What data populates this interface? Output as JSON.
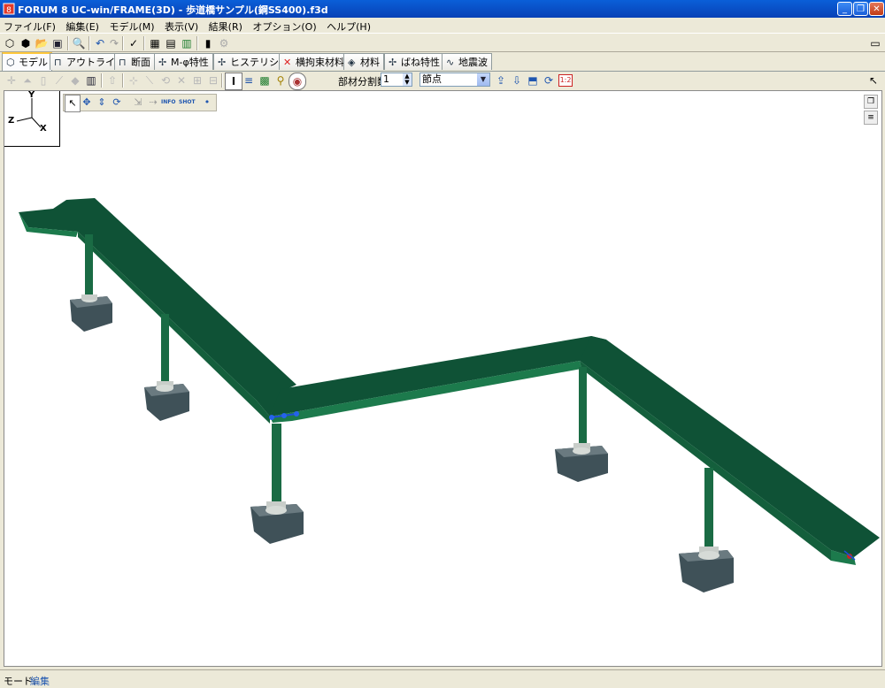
{
  "window": {
    "title": "FORUM 8  UC-win/FRAME(3D) - 歩道橋サンプル(鋼SS400).f3d",
    "minimize_icon": "minimize-icon",
    "maximize_icon": "restore-icon",
    "close_icon": "close-icon"
  },
  "menu": [
    "ファイル(F)",
    "編集(E)",
    "モデル(M)",
    "表示(V)",
    "結果(R)",
    "オプション(O)",
    "ヘルプ(H)"
  ],
  "tabs": [
    {
      "label": "モデル",
      "icon": "model-icon",
      "active": true
    },
    {
      "label": "アウトライン",
      "icon": "outline-icon"
    },
    {
      "label": "断面",
      "icon": "section-icon"
    },
    {
      "label": "M-φ特性",
      "icon": "m-phi-icon"
    },
    {
      "label": "ヒステリシス",
      "icon": "hysteresis-icon"
    },
    {
      "label": "横拘束材料",
      "icon": "confine-icon"
    },
    {
      "label": "材料",
      "icon": "material-icon"
    },
    {
      "label": "ばね特性",
      "icon": "spring-icon"
    },
    {
      "label": "地震波",
      "icon": "wave-icon"
    }
  ],
  "toolbar2": {
    "divisions_label": "部材分割数",
    "divisions_value": "1",
    "select_value": "節点",
    "zoom_badge": "1:2"
  },
  "axes": {
    "y": "Y",
    "z": "Z",
    "x": "X"
  },
  "view_tools": {
    "info": "INFO",
    "shot": "SHOT"
  },
  "status": {
    "mode_label": "モード:",
    "mode_value": "編集"
  },
  "colors": {
    "deck_top": "#0f5236",
    "deck_side": "#1c7a4c",
    "pier": "#1a6b44",
    "bearing": "#d6dbd7",
    "footing_front": "#3f5158",
    "footing_top": "#6a7a80",
    "title_bar": "#0a5fd8"
  }
}
